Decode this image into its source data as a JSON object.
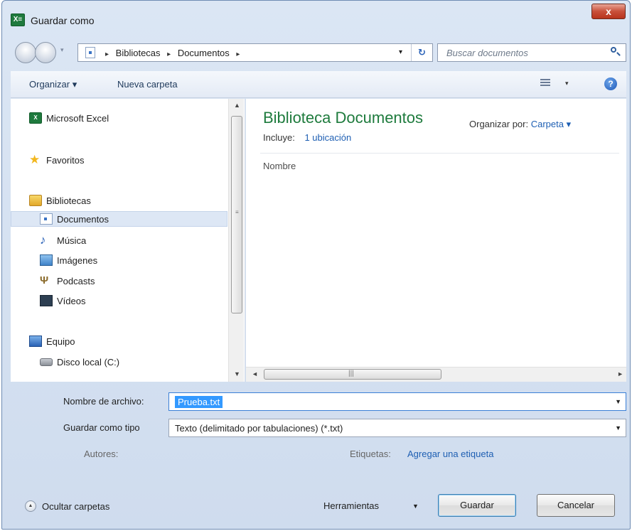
{
  "window": {
    "title": "Guardar como",
    "app_icon_text": "X≡",
    "close_glyph": "x"
  },
  "address": {
    "crumbs": [
      "Bibliotecas",
      "Documentos"
    ],
    "separator": "▸",
    "dropdown_glyph": "▾",
    "refresh_glyph": "↻"
  },
  "search": {
    "placeholder": "Buscar documentos"
  },
  "toolbar": {
    "organize_label": "Organizar ▾",
    "new_folder_label": "Nueva carpeta",
    "view_drop_glyph": "▾",
    "help_glyph": "?"
  },
  "nav": {
    "items": [
      {
        "label": "Microsoft Excel",
        "icon": "excel-icon"
      },
      {
        "label": "Favoritos",
        "icon": "star-icon"
      },
      {
        "label": "Bibliotecas",
        "icon": "library-icon"
      },
      {
        "label": "Documentos",
        "icon": "document-icon",
        "selected": true
      },
      {
        "label": "Música",
        "icon": "music-icon"
      },
      {
        "label": "Imágenes",
        "icon": "image-icon"
      },
      {
        "label": "Podcasts",
        "icon": "podcast-icon"
      },
      {
        "label": "Vídeos",
        "icon": "video-icon"
      },
      {
        "label": "Equipo",
        "icon": "computer-icon"
      },
      {
        "label": "Disco local (C:)",
        "icon": "disk-icon"
      }
    ]
  },
  "content": {
    "library_title": "Biblioteca Documentos",
    "includes_label": "Incluye:",
    "includes_link": "1 ubicación",
    "arrange_label": "Organizar por:",
    "arrange_value": "Carpeta ▾",
    "column_name": "Nombre"
  },
  "form": {
    "filename_label": "Nombre de archivo:",
    "filename_value": "Prueba.txt",
    "type_label": "Guardar como tipo",
    "type_value": "Texto (delimitado por tabulaciones) (*.txt)",
    "authors_label": "Autores:",
    "tags_label": "Etiquetas:",
    "tags_link": "Agregar una etiqueta"
  },
  "footer": {
    "hide_folders_label": "Ocultar carpetas",
    "tools_label": "Herramientas",
    "save_label": "Guardar",
    "cancel_label": "Cancelar"
  },
  "colors": {
    "accent_green": "#1e7b3d",
    "link_blue": "#1e5fb3",
    "selection_blue": "#3399ff"
  }
}
